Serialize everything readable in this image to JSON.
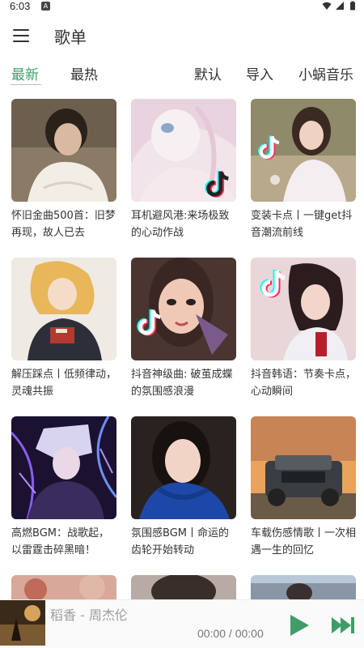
{
  "status_bar": {
    "time": "6:03",
    "app_badge": "A"
  },
  "header": {
    "title": "歌单"
  },
  "tabs": [
    {
      "label": "最新",
      "active": true
    },
    {
      "label": "最热",
      "active": false
    },
    {
      "label": "默认",
      "active": false
    },
    {
      "label": "导入",
      "active": false
    },
    {
      "label": "小蜗音乐",
      "active": false
    }
  ],
  "playlists": [
    {
      "name": "怀旧金曲500首：旧梦再现，故人已去"
    },
    {
      "name": "耳机避风港:来场极致的心动作战"
    },
    {
      "name": "变装卡点丨一键get抖音潮流前线"
    },
    {
      "name": "解压踩点丨低频律动，灵魂共振"
    },
    {
      "name": "抖音神级曲: 破茧成蝶的氛围感浪漫"
    },
    {
      "name": "抖音韩语：节奏卡点，心动瞬间"
    },
    {
      "name": "高燃BGM：战歌起，以雷霆击碎黑暗！"
    },
    {
      "name": "氛围感BGM丨命运的齿轮开始转动"
    },
    {
      "name": "车载伤感情歌丨一次相遇一生的回忆"
    }
  ],
  "player": {
    "song": "稻香 - 周杰伦",
    "time": "00:00 / 00:00"
  },
  "colors": {
    "accent": "#3f9e68",
    "text": "#333333",
    "muted": "#9e9e9e"
  }
}
